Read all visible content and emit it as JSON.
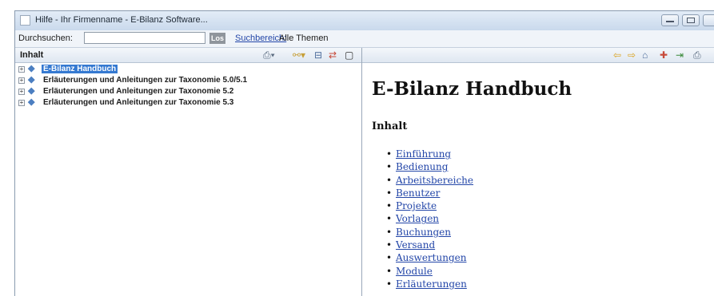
{
  "window": {
    "title": "Hilfe - Ihr Firmenname - E-Bilanz Software..."
  },
  "search": {
    "label": "Durchsuchen:",
    "value": "",
    "button": "Los",
    "scope_link": "Suchbereich:",
    "scope_value": "Alle Themen"
  },
  "left_panel": {
    "title": "Inhalt",
    "tree": [
      {
        "label": "E-Bilanz Handbuch",
        "selected": true
      },
      {
        "label": "Erläuterungen und Anleitungen zur Taxonomie 5.0/5.1",
        "selected": false
      },
      {
        "label": "Erläuterungen und Anleitungen zur Taxonomie 5.2",
        "selected": false
      },
      {
        "label": "Erläuterungen und Anleitungen zur Taxonomie 5.3",
        "selected": false
      }
    ]
  },
  "content": {
    "title": "E-Bilanz Handbuch",
    "section": "Inhalt",
    "links": [
      "Einführung",
      "Bedienung",
      "Arbeitsbereiche",
      "Benutzer",
      "Projekte",
      "Vorlagen",
      "Buchungen",
      "Versand",
      "Auswertungen",
      "Module",
      "Erläuterungen"
    ]
  },
  "icons": {
    "left_toolbar": [
      "print-icon",
      "link-icon",
      "collapse-all-icon",
      "sync-toc-icon",
      "maximize-icon"
    ],
    "right_toolbar": [
      "back-icon",
      "forward-icon",
      "home-icon",
      "bookmark-icon",
      "show-in-toc-icon",
      "print-icon"
    ]
  },
  "colors": {
    "selection": "#3579d1",
    "link": "#2346a8",
    "chrome": "#dbe6f3"
  }
}
